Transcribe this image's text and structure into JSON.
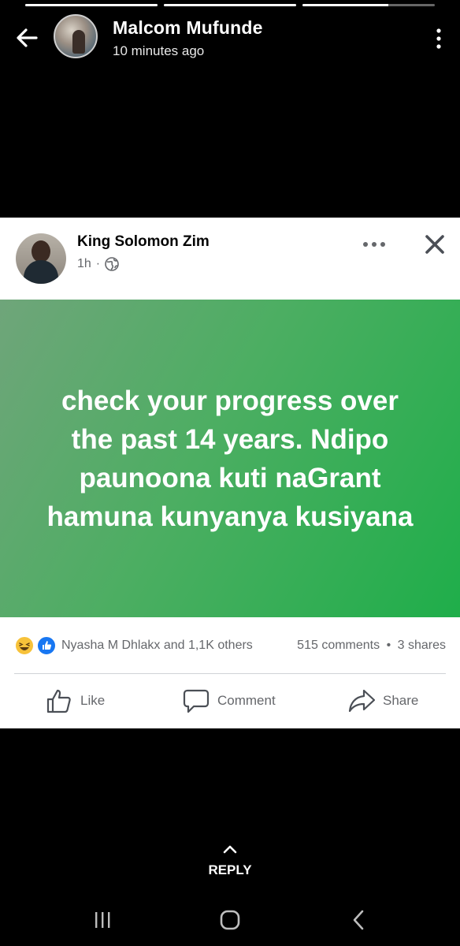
{
  "story": {
    "progress": [
      1.0,
      1.0,
      0.65
    ],
    "user_name": "Malcom Mufunde",
    "time": "10 minutes ago"
  },
  "post": {
    "author": "King Solomon Zim",
    "time": "1h",
    "separator": "·",
    "privacy_icon": "globe-icon",
    "text_lines": [
      "check your progress over",
      "the past 14 years. Ndipo",
      "paunoona kuti naGrant",
      "hamuna kunyanya kusiyana"
    ],
    "background_colors": [
      "#6fa57a",
      "#1fae4a"
    ],
    "reactions": {
      "icons": [
        "haha-icon",
        "like-icon"
      ],
      "reactors": "Nyasha M Dhlakx and 1,1K others",
      "comments": "515 comments",
      "dot": "•",
      "shares": "3 shares"
    },
    "actions": {
      "like": "Like",
      "comment": "Comment",
      "share": "Share"
    }
  },
  "reply_label": "REPLY",
  "colors": {
    "facebook_blue": "#1877f2",
    "haha_yellow": "#f7c23a",
    "meta_gray": "#65676b"
  }
}
